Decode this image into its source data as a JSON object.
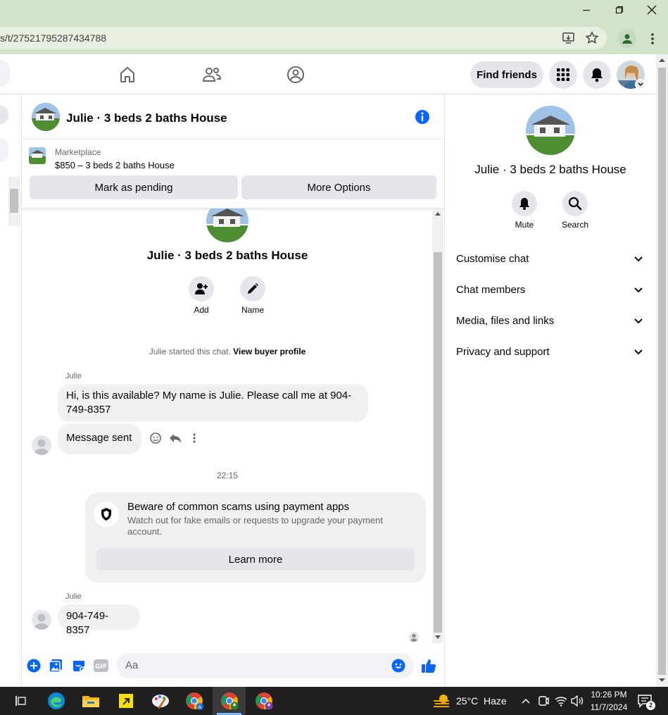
{
  "browser": {
    "url": "s/t/27521795287434788"
  },
  "fb_header": {
    "find_friends_label": "Find friends"
  },
  "chat_header": {
    "title": "Julie · 3 beds 2 baths House"
  },
  "listing": {
    "source": "Marketplace",
    "summary": "$850 – 3 beds 2 baths House",
    "mark_pending_label": "Mark as pending",
    "more_options_label": "More Options"
  },
  "chat_intro": {
    "title": "Julie · 3 beds 2 baths House",
    "add_label": "Add",
    "name_label": "Name",
    "started_text": "Julie started this chat.",
    "buyer_profile_link": "View buyer profile"
  },
  "messages": [
    {
      "sender": "Julie",
      "text": "Hi, is this available? My name is Julie. Please call me at 904-749-8357"
    },
    {
      "sender": "",
      "text": "Message sent"
    }
  ],
  "timestamp": "22:15",
  "scam_notice": {
    "title": "Beware of common scams using payment apps",
    "body": "Watch out for fake emails or requests to upgrade your payment account.",
    "learn_more_label": "Learn more"
  },
  "second_message": {
    "sender": "Julie",
    "text": "904-749-8357"
  },
  "composer": {
    "placeholder": "Aa"
  },
  "right_panel": {
    "title": "Julie · 3 beds 2 baths House",
    "mute_label": "Mute",
    "search_label": "Search",
    "sections": [
      "Customise chat",
      "Chat members",
      "Media, files and links",
      "Privacy and support"
    ]
  },
  "taskbar": {
    "weather_temp": "25°C",
    "weather_desc": "Haze",
    "time": "10:26 PM",
    "date": "11/7/2024",
    "notification_count": "2"
  },
  "colors": {
    "fb_blue": "#0866ff",
    "chrome_frame": "#d3e3c9",
    "bubble_grey": "#f0f0f0"
  }
}
